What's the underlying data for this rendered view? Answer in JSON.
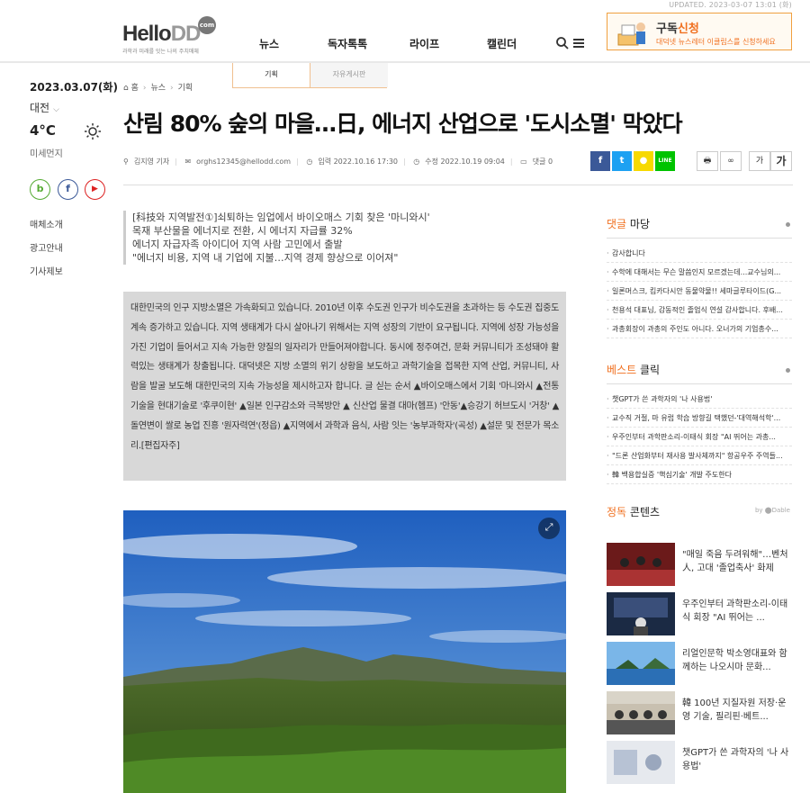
{
  "header": {
    "updated": "UPDATED. 2023-03-07 13:01 (화)",
    "logo_main": "Hello",
    "logo_dd": "DD",
    "logo_com": "com",
    "slogan": "과학과 미래를 잇는 나의 주치매체",
    "nav": [
      "뉴스",
      "독자톡톡",
      "라이프",
      "캘린더"
    ],
    "subscribe_title": "구독",
    "subscribe_highlight": "신청",
    "subscribe_sub": "대덕넷 뉴스레터 이클립스를 신청하세요",
    "submenu": [
      "기획",
      "자유게시판"
    ]
  },
  "sidebar": {
    "date": "2023.03.07(화)",
    "city": "대전",
    "temperature": "4°C",
    "dust": "미세먼지",
    "social": [
      {
        "label": "b",
        "color": "#55aa33"
      },
      {
        "label": "f",
        "color": "#3b5998"
      },
      {
        "label": "▶",
        "color": "#dd2222"
      }
    ],
    "links": [
      "매체소개",
      "광고안내",
      "기사제보"
    ]
  },
  "article": {
    "breadcrumb": [
      "홈",
      "뉴스",
      "기획"
    ],
    "title": "산림 80% 숲의 마을…日, 에너지 산업으로 '도시소멸' 막았다",
    "meta": {
      "author": "김지영 기자",
      "email": "orghs12345@hellodd.com",
      "published": "입력 2022.10.16 17:30",
      "modified": "수정 2022.10.19 09:04",
      "comments": "댓글 0"
    },
    "share": [
      {
        "label": "f",
        "color": "#3b5998"
      },
      {
        "label": "t",
        "color": "#1da1f2"
      },
      {
        "label": "●",
        "color": "#f7d900"
      },
      {
        "label": "LINE",
        "color": "#00c300"
      }
    ],
    "font_small": "가",
    "font_large": "가",
    "summary": [
      "[科技와 지역발전①]쇠퇴하는 임업에서 바이오매스 기회 찾은 '마니와시'",
      "목재 부산물을 에너지로 전환, 시 에너지 자급률 32%",
      "에너지 자급자족 아이디어 지역 사람 고민에서 출발",
      "\"에너지 비용, 지역 내 기업에 지불…지역 경제 향상으로 이어져\""
    ],
    "intro": "대한민국의 인구 지방소멸은 가속화되고 있습니다. 2010년 이후 수도권 인구가 비수도권을 초과하는 등 수도권 집중도 계속 증가하고 있습니다. 지역 생태계가 다시 살아나기 위해서는 지역 성장의 기반이 요구됩니다. 지역에 성장 가능성을 가진 기업이 들어서고 지속 가능한 양질의 일자리가 만들어져야합니다. 동시에 정주여건, 문화 커뮤니티가 조성돼야 활력있는 생태계가 창출됩니다. 대덕넷은 지방 소멸의 위기 상황을 보도하고 과학기술을 접목한 지역 산업, 커뮤니티, 사람을 발굴 보도해 대한민국의 지속 가능성을 제시하고자 합니다. 글 싣는 순서 ▲바이오매스에서 기회 '마니와시 ▲전통기술을 현대기술로 '후쿠이현' ▲일본 인구감소와 극복방안 ▲ 신산업 물결 대마(헴프) '안동'▲승강기 허브도시 '거창' ▲돌연변이 쌀로 농업 진흥 '원자력연'(정읍) ▲지역에서 과학과 음식, 사람 잇는 '농부과학자'(곡성) ▲설문 및 전문가 목소리.[편집자주]"
  },
  "right": {
    "comments_title_hl": "댓글",
    "comments_title": " 마당",
    "comments": [
      "감사합니다",
      "수학에 대해서는 무슨 말씀인지 모르겠는데...교수님의...",
      "일론머스크, 킴카다시안 동물약물!! 세마글루타이드(G...",
      "천용석 대표님, 감동적인 졸업식 연설 감사합니다. 후배...",
      "과총회장이 과총의 주인도 아니다. 오너가의 기업총수..."
    ],
    "best_title_hl": "베스트",
    "best_title": " 클릭",
    "best": [
      "챗GPT가 쓴 과학자의 '나 사용법'",
      "교수직 거절, 마 유럽 학습 방향길 택했던-'대역해석학'...",
      "우주인부터 과학판소리-이태식 회장 \"AI 뛰어는 과총...",
      "\"드론 산업화부터 재사용 발사체까지\" 항공우주 주역들...",
      "韓 백용합실증 '핵심기술' 개발 주도한다"
    ],
    "contents_title_hl": "정독",
    "contents_title": " 콘텐츠",
    "contents_by": "by ⬤Dable",
    "contents": [
      "\"매일 죽음 두려워해\"…벤처人, 고대 '졸업축사' 화제",
      "우주인부터 과학판소리-이태식 회장 \"AI 뛰어는 ...",
      "리얼인문학 박소영대표와 함께하는 나오시마 문화...",
      "韓 100년 지질자원 저장·운영 기술, 필리핀·베트...",
      "챗GPT가 쓴 과학자의 '나 사용법'"
    ]
  },
  "colors": {
    "accent": "#f07020",
    "intro_bg": "#d8d8d8"
  }
}
